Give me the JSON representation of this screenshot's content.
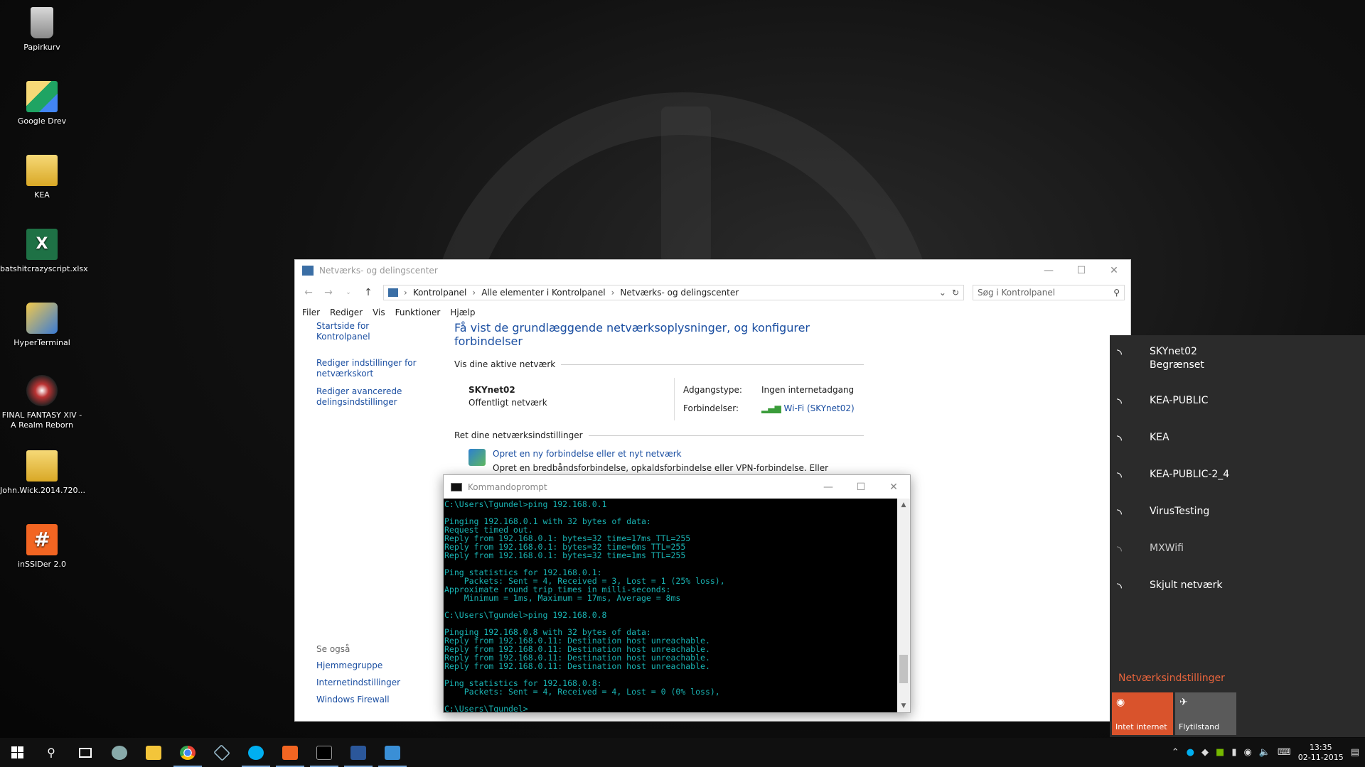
{
  "desktop": {
    "icons": [
      {
        "label": "Papirkurv",
        "icon": "recycle-bin-icon"
      },
      {
        "label": "Google Drev",
        "icon": "google-drive-icon"
      },
      {
        "label": "KEA",
        "icon": "folder-icon"
      },
      {
        "label": "batshitcrazyscript.xlsx",
        "icon": "excel-file-icon"
      },
      {
        "label": "HyperTerminal",
        "icon": "hyperterminal-icon"
      },
      {
        "label": "FINAL FANTASY XIV - A Realm Reborn",
        "icon": "final-fantasy-icon"
      },
      {
        "label": "John.Wick.2014.720...",
        "icon": "folder-icon"
      },
      {
        "label": "inSSIDer 2.0",
        "icon": "inssider-icon"
      }
    ]
  },
  "control_panel": {
    "title": "Netværks- og delingscenter",
    "breadcrumb": [
      "Kontrolpanel",
      "Alle elementer i Kontrolpanel",
      "Netværks- og delingscenter"
    ],
    "search_placeholder": "Søg i Kontrolpanel",
    "menu": [
      "Filer",
      "Rediger",
      "Vis",
      "Funktioner",
      "Hjælp"
    ],
    "left_links": [
      "Startside for Kontrolpanel",
      "Rediger indstillinger for netværkskort",
      "Rediger avancerede delingsindstillinger"
    ],
    "see_also_title": "Se også",
    "see_also_links": [
      "Hjemmegruppe",
      "Internetindstillinger",
      "Windows Firewall"
    ],
    "heading": "Få vist de grundlæggende netværksoplysninger, og konfigurer forbindelser",
    "active_networks_title": "Vis dine aktive netværk",
    "network_name": "SKYnet02",
    "network_type": "Offentligt netværk",
    "access_type_label": "Adgangstype:",
    "access_type_value": "Ingen internetadgang",
    "connections_label": "Forbindelser:",
    "connections_value": "Wi-Fi (SKYnet02)",
    "change_settings_title": "Ret dine netværksindstillinger",
    "task_link": "Opret en ny forbindelse eller et nyt netværk",
    "task_desc": "Opret en bredbåndsforbindelse, opkaldsforbindelse eller VPN-forbindelse. Eller konfigurer en router eller et adgangspunkt."
  },
  "cmd": {
    "title": "Kommandoprompt",
    "lines": [
      "C:\\Users\\Tgundel>ping 192.168.0.1",
      "",
      "Pinging 192.168.0.1 with 32 bytes of data:",
      "Request timed out.",
      "Reply from 192.168.0.1: bytes=32 time=17ms TTL=255",
      "Reply from 192.168.0.1: bytes=32 time=6ms TTL=255",
      "Reply from 192.168.0.1: bytes=32 time=1ms TTL=255",
      "",
      "Ping statistics for 192.168.0.1:",
      "    Packets: Sent = 4, Received = 3, Lost = 1 (25% loss),",
      "Approximate round trip times in milli-seconds:",
      "    Minimum = 1ms, Maximum = 17ms, Average = 8ms",
      "",
      "C:\\Users\\Tgundel>ping 192.168.0.8",
      "",
      "Pinging 192.168.0.8 with 32 bytes of data:",
      "Reply from 192.168.0.11: Destination host unreachable.",
      "Reply from 192.168.0.11: Destination host unreachable.",
      "Reply from 192.168.0.11: Destination host unreachable.",
      "Reply from 192.168.0.11: Destination host unreachable.",
      "",
      "Ping statistics for 192.168.0.8:",
      "    Packets: Sent = 4, Received = 4, Lost = 0 (0% loss),",
      "",
      "C:\\Users\\Tgundel>"
    ]
  },
  "network_flyout": {
    "networks": [
      {
        "name": "SKYnet02",
        "status": "Begrænset",
        "secured": false,
        "dim": false
      },
      {
        "name": "KEA-PUBLIC",
        "status": "",
        "secured": false,
        "dim": false
      },
      {
        "name": "KEA",
        "status": "",
        "secured": true,
        "dim": false
      },
      {
        "name": "KEA-PUBLIC-2_4",
        "status": "",
        "secured": false,
        "dim": false
      },
      {
        "name": "VirusTesting",
        "status": "",
        "secured": true,
        "dim": false
      },
      {
        "name": "MXWifi",
        "status": "",
        "secured": true,
        "dim": true
      },
      {
        "name": "Skjult netværk",
        "status": "",
        "secured": true,
        "dim": false
      }
    ],
    "settings_link": "Netværksindstillinger",
    "tiles": [
      {
        "label": "Intet internet",
        "icon": "wifi-icon",
        "color": "#d9532c"
      },
      {
        "label": "Flytilstand",
        "icon": "airplane-icon",
        "color": "#5a5a5a"
      }
    ]
  },
  "taskbar": {
    "apps": [
      "start-icon",
      "search-icon",
      "task-view-icon",
      "app-icon",
      "file-explorer-icon",
      "chrome-icon",
      "virtualbox-icon",
      "skype-icon",
      "inssider-icon",
      "cmd-icon",
      "word-icon",
      "control-panel-icon"
    ],
    "time": "13:35",
    "date": "02-11-2015"
  }
}
